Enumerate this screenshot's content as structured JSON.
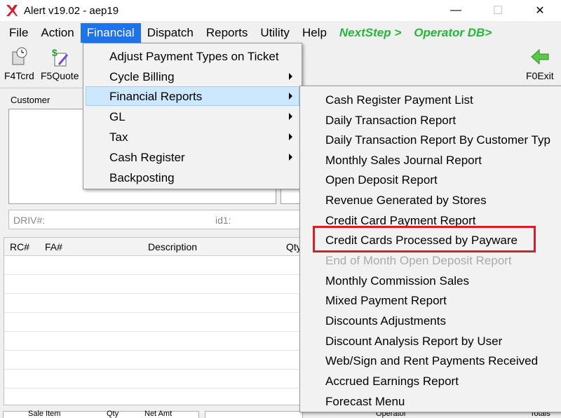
{
  "window": {
    "title": "Alert v19.02 - aep19",
    "minimize": "—",
    "maximize": "☐",
    "close": "✕"
  },
  "menubar": {
    "items": [
      "File",
      "Action",
      "Financial",
      "Dispatch",
      "Reports",
      "Utility",
      "Help"
    ],
    "nextstep": "NextStep >",
    "operator_db": "Operator DB>"
  },
  "toolbar": {
    "f4": "F4Tcrd",
    "f5": "F5Quote",
    "f0": "F0Exit"
  },
  "form": {
    "customer_label": "Customer",
    "driv_label": "DRIV#:",
    "id1_label": "id1:"
  },
  "grid": {
    "col_rc": "RC#",
    "col_fa": "FA#",
    "col_desc": "Description",
    "col_qty": "Qty"
  },
  "bottom": {
    "sale_item": "Sale Item",
    "qty": "Qty",
    "net_amt": "Net Amt",
    "operator": "Operator",
    "totals": "Totals"
  },
  "financial_menu": {
    "items": [
      "Adjust Payment Types on Ticket",
      "Cycle Billing",
      "Financial Reports",
      "GL",
      "Tax",
      "Cash Register",
      "Backposting"
    ]
  },
  "financial_reports_menu": {
    "items": [
      "Cash Register Payment List",
      "Daily Transaction Report",
      "Daily Transaction Report By Customer Typ",
      "Monthly Sales Journal Report",
      "Open Deposit Report",
      "Revenue Generated by Stores",
      "Credit Card Payment Report",
      "Credit Cards Processed by Payware",
      "End of Month Open Deposit Report",
      "Monthly Commission Sales",
      "Mixed Payment Report",
      "Discounts Adjustments",
      "Discount Analysis Report by User",
      "Web/Sign and Rent Payments Received",
      "Accrued Earnings Report",
      "Forecast Menu"
    ]
  },
  "colors": {
    "menu_active": "#1e73e8",
    "green_link": "#27b53a",
    "highlight_red": "#d4202a",
    "hover_blue": "#cce8ff"
  }
}
